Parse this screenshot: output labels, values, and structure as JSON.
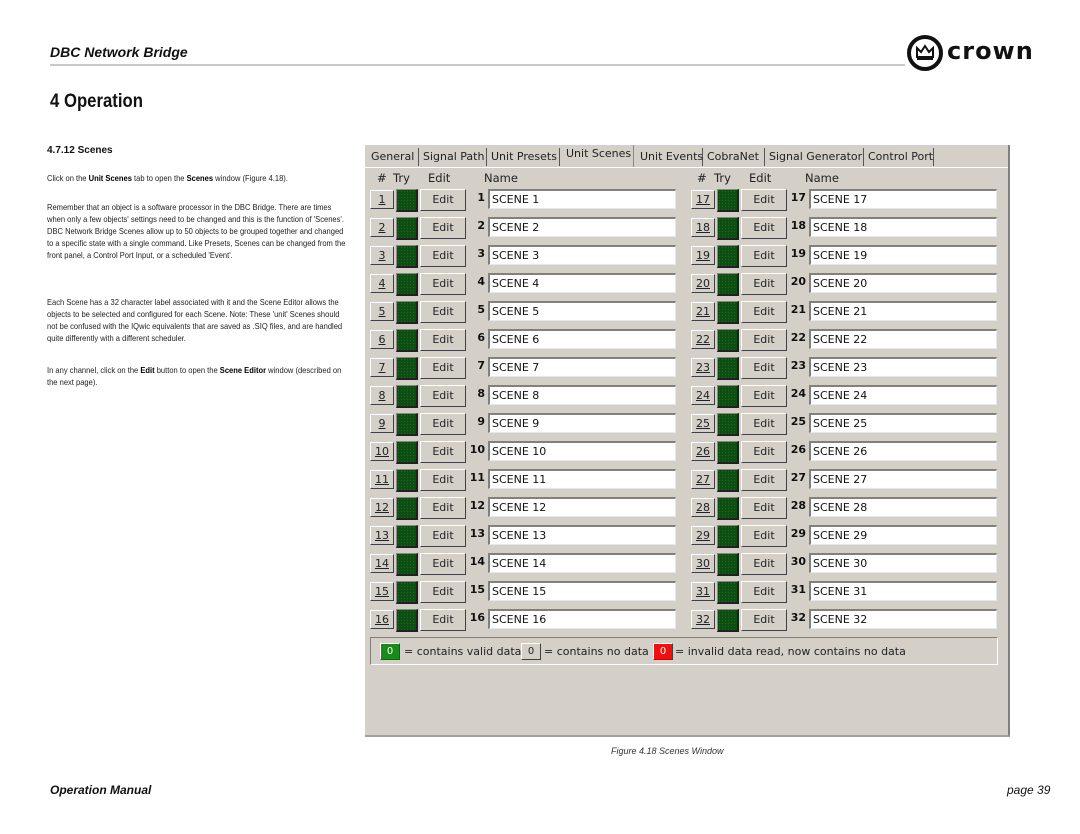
{
  "header": {
    "title": "DBC Network Bridge",
    "logo_text": "crown",
    "logo_icon": "crown-icon"
  },
  "section": {
    "title": "4 Operation",
    "subtitle": "4.7.12 Scenes",
    "paragraphs": {
      "p1": {
        "a": "Click on the ",
        "b1": "Unit Scenes",
        "c": " tab to open the ",
        "b2": "Scenes",
        "d": " window (Figure 4.18)."
      },
      "p2": "Remember that an object is a software processor in the DBC Bridge. There are times when only a few objects' settings need to be changed and this is the function of 'Scenes'. DBC Network Bridge Scenes allow up to 50 objects to be grouped together and changed to a specific state with a single command. Like Presets, Scenes can be changed from the front panel, a Control Port Input, or a scheduled 'Event'.",
      "p3": "Each Scene has a 32 character label associated with it and the Scene Editor allows the objects to be selected and configured for each Scene. Note: These 'unit' Scenes should not be confused with the IQwic equivalents that are saved as .SIQ files, and are handled quite differently with a different scheduler.",
      "p4": {
        "a": "In any channel, click on the ",
        "b1": "Edit",
        "c": " button to open the ",
        "b2": "Scene Editor",
        "d": " window (described on the next page)."
      }
    }
  },
  "window": {
    "tabs": [
      "General",
      "Signal Path",
      "Unit Presets",
      "Unit Scenes",
      "Unit Events",
      "CobraNet",
      "Signal Generator",
      "Control Port"
    ],
    "active_tab": "Unit Scenes",
    "column_headers": {
      "num": "#",
      "try": "Try",
      "edit": "Edit",
      "name": "Name"
    },
    "edit_label": "Edit",
    "try_color": "#0d4d12",
    "scenes": [
      {
        "num": "1",
        "name": "SCENE 1"
      },
      {
        "num": "2",
        "name": "SCENE 2"
      },
      {
        "num": "3",
        "name": "SCENE 3"
      },
      {
        "num": "4",
        "name": "SCENE 4"
      },
      {
        "num": "5",
        "name": "SCENE 5"
      },
      {
        "num": "6",
        "name": "SCENE 6"
      },
      {
        "num": "7",
        "name": "SCENE 7"
      },
      {
        "num": "8",
        "name": "SCENE 8"
      },
      {
        "num": "9",
        "name": "SCENE 9"
      },
      {
        "num": "10",
        "name": "SCENE 10"
      },
      {
        "num": "11",
        "name": "SCENE 11"
      },
      {
        "num": "12",
        "name": "SCENE 12"
      },
      {
        "num": "13",
        "name": "SCENE 13"
      },
      {
        "num": "14",
        "name": "SCENE 14"
      },
      {
        "num": "15",
        "name": "SCENE 15"
      },
      {
        "num": "16",
        "name": "SCENE 16"
      },
      {
        "num": "17",
        "name": "SCENE 17"
      },
      {
        "num": "18",
        "name": "SCENE 18"
      },
      {
        "num": "19",
        "name": "SCENE 19"
      },
      {
        "num": "20",
        "name": "SCENE 20"
      },
      {
        "num": "21",
        "name": "SCENE 21"
      },
      {
        "num": "22",
        "name": "SCENE 22"
      },
      {
        "num": "23",
        "name": "SCENE 23"
      },
      {
        "num": "24",
        "name": "SCENE 24"
      },
      {
        "num": "25",
        "name": "SCENE 25"
      },
      {
        "num": "26",
        "name": "SCENE 26"
      },
      {
        "num": "27",
        "name": "SCENE 27"
      },
      {
        "num": "28",
        "name": "SCENE 28"
      },
      {
        "num": "29",
        "name": "SCENE 29"
      },
      {
        "num": "30",
        "name": "SCENE 30"
      },
      {
        "num": "31",
        "name": "SCENE 31"
      },
      {
        "num": "32",
        "name": "SCENE 32"
      }
    ],
    "legend": [
      {
        "value": "0",
        "color": "#1a8a1a",
        "text": "= contains valid data"
      },
      {
        "value": "0",
        "color": "#d4d0c8",
        "text": "= contains no data"
      },
      {
        "value": "0",
        "color": "#ee1111",
        "text": "= invalid data read, now contains no data"
      }
    ]
  },
  "caption": "Figure 4.18 Scenes Window",
  "footer": {
    "left": "Operation Manual",
    "right": "page 39"
  }
}
